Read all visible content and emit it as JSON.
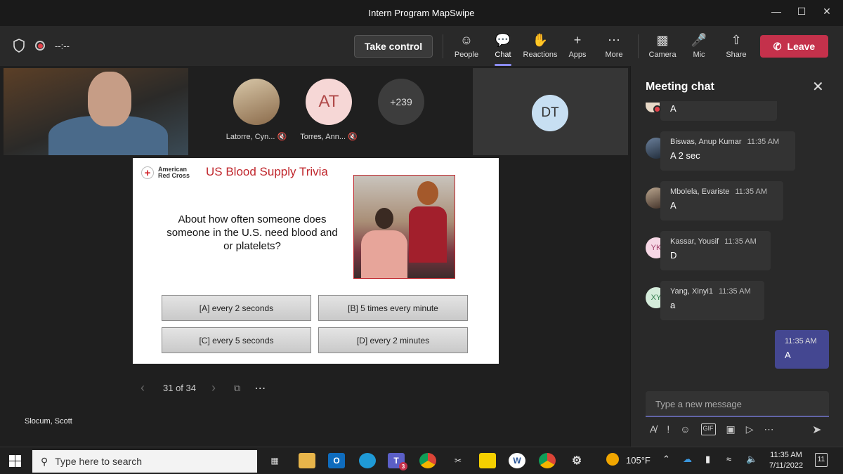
{
  "window": {
    "title": "Intern Program MapSwipe",
    "minimize": "—",
    "maximize": "☐",
    "close": "✕"
  },
  "toolbar": {
    "timer": "--:--",
    "take_control": "Take control",
    "buttons": [
      {
        "label": "People",
        "icon": "people-icon"
      },
      {
        "label": "Chat",
        "icon": "chat-icon"
      },
      {
        "label": "Reactions",
        "icon": "reactions-icon"
      },
      {
        "label": "Apps",
        "icon": "apps-icon"
      },
      {
        "label": "More",
        "icon": "more-icon"
      },
      {
        "label": "Camera",
        "icon": "camera-off-icon"
      },
      {
        "label": "Mic",
        "icon": "mic-off-icon"
      },
      {
        "label": "Share",
        "icon": "share-icon"
      }
    ],
    "leave": "Leave",
    "active": "Chat"
  },
  "participants": [
    {
      "name": "Latorre, Cyn...",
      "initials": "",
      "muted": true
    },
    {
      "name": "Torres, Ann...",
      "initials": "AT",
      "muted": true
    },
    {
      "name": "",
      "initials": "+239",
      "muted": false
    }
  ],
  "dt_tile": {
    "initials": "DT"
  },
  "video_name": "Slocum, Scott",
  "slide": {
    "logo_line1": "American",
    "logo_line2": "Red Cross",
    "title": "US Blood Supply Trivia",
    "question": "About how often someone does someone in the U.S. need blood and or platelets?",
    "answers": [
      "[A] every 2 seconds",
      "[B] 5 times every minute",
      "[C] every 5 seconds",
      "[D] every 2 minutes"
    ]
  },
  "pager": {
    "text": "31 of 34"
  },
  "chat": {
    "title": "Meeting chat",
    "partial_text": "A",
    "messages": [
      {
        "initials": "",
        "name": "Biswas, Anup Kumar",
        "time": "11:35 AM",
        "text": "A 2 sec"
      },
      {
        "initials": "",
        "name": "Mbolela, Evariste",
        "time": "11:35 AM",
        "text": "A"
      },
      {
        "initials": "YK",
        "name": "Kassar, Yousif",
        "time": "11:35 AM",
        "text": "D"
      },
      {
        "initials": "XY",
        "name": "Yang, Xinyi1",
        "time": "11:35 AM",
        "text": "a"
      }
    ],
    "my_message": {
      "time": "11:35 AM",
      "text": "A"
    },
    "compose_placeholder": "Type a new message",
    "compose_gif": "GIF"
  },
  "taskbar": {
    "search_placeholder": "Type here to search",
    "teams_badge": "3",
    "weather": "105°F",
    "time": "11:35 AM",
    "date": "7/11/2022",
    "notifications": "11"
  },
  "colors": {
    "accent": "#6264a7",
    "leave": "#c4314b",
    "red_cross": "#c0272d"
  }
}
